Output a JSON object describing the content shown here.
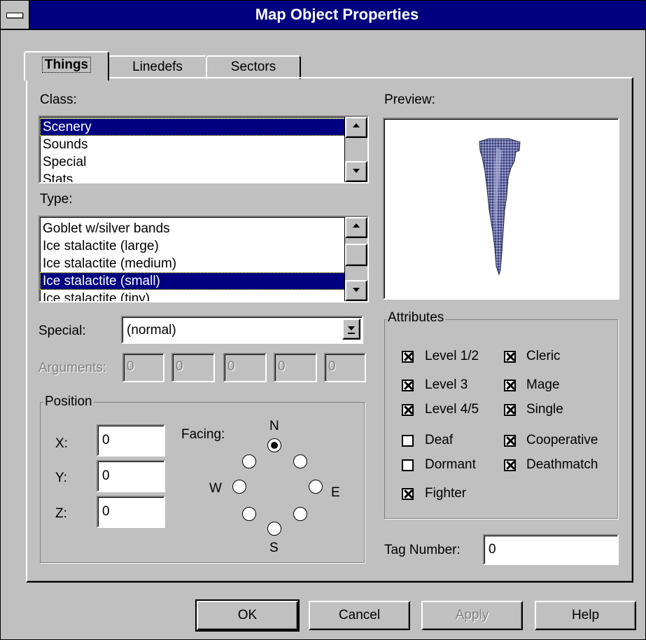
{
  "window": {
    "title": "Map Object Properties"
  },
  "tabs": [
    {
      "label": "Things"
    },
    {
      "label": "Linedefs"
    },
    {
      "label": "Sectors"
    }
  ],
  "class_list": {
    "label": "Class:",
    "items": [
      "Scenery",
      "Sounds",
      "Special",
      "Stats"
    ],
    "selected": "Scenery"
  },
  "type_list": {
    "label": "Type:",
    "items": [
      "Goblet w/silver bands",
      "Ice stalactite (large)",
      "Ice stalactite (medium)",
      "Ice stalactite (small)",
      "Ice stalactite (tiny)"
    ],
    "selected": "Ice stalactite (small)"
  },
  "special": {
    "label": "Special:",
    "value": "(normal)"
  },
  "arguments": {
    "label": "Arguments:",
    "values": [
      "0",
      "0",
      "0",
      "0",
      "0"
    ]
  },
  "position": {
    "title": "Position",
    "x_label": "X:",
    "x_value": "0",
    "y_label": "Y:",
    "y_value": "0",
    "z_label": "Z:",
    "z_value": "0",
    "facing_label": "Facing:",
    "n": "N",
    "s": "S",
    "e": "E",
    "w": "W"
  },
  "preview": {
    "label": "Preview:"
  },
  "attributes": {
    "title": "Attributes",
    "left": [
      {
        "label": "Level 1/2",
        "checked": true
      },
      {
        "label": "Level 3",
        "checked": true
      },
      {
        "label": "Level 4/5",
        "checked": true
      },
      {
        "label": "Deaf",
        "checked": false
      },
      {
        "label": "Dormant",
        "checked": false
      },
      {
        "label": "Fighter",
        "checked": true
      }
    ],
    "right": [
      {
        "label": "Cleric",
        "checked": true
      },
      {
        "label": "Mage",
        "checked": true
      },
      {
        "label": "Single",
        "checked": true
      },
      {
        "label": "Cooperative",
        "checked": true
      },
      {
        "label": "Deathmatch",
        "checked": true
      }
    ]
  },
  "tag": {
    "label": "Tag Number:",
    "value": "0"
  },
  "buttons": {
    "ok": "OK",
    "cancel": "Cancel",
    "apply": "Apply",
    "help": "Help"
  },
  "colors": {
    "title_bar": "#000080",
    "face": "#c0c0c0",
    "selection": "#000080"
  }
}
